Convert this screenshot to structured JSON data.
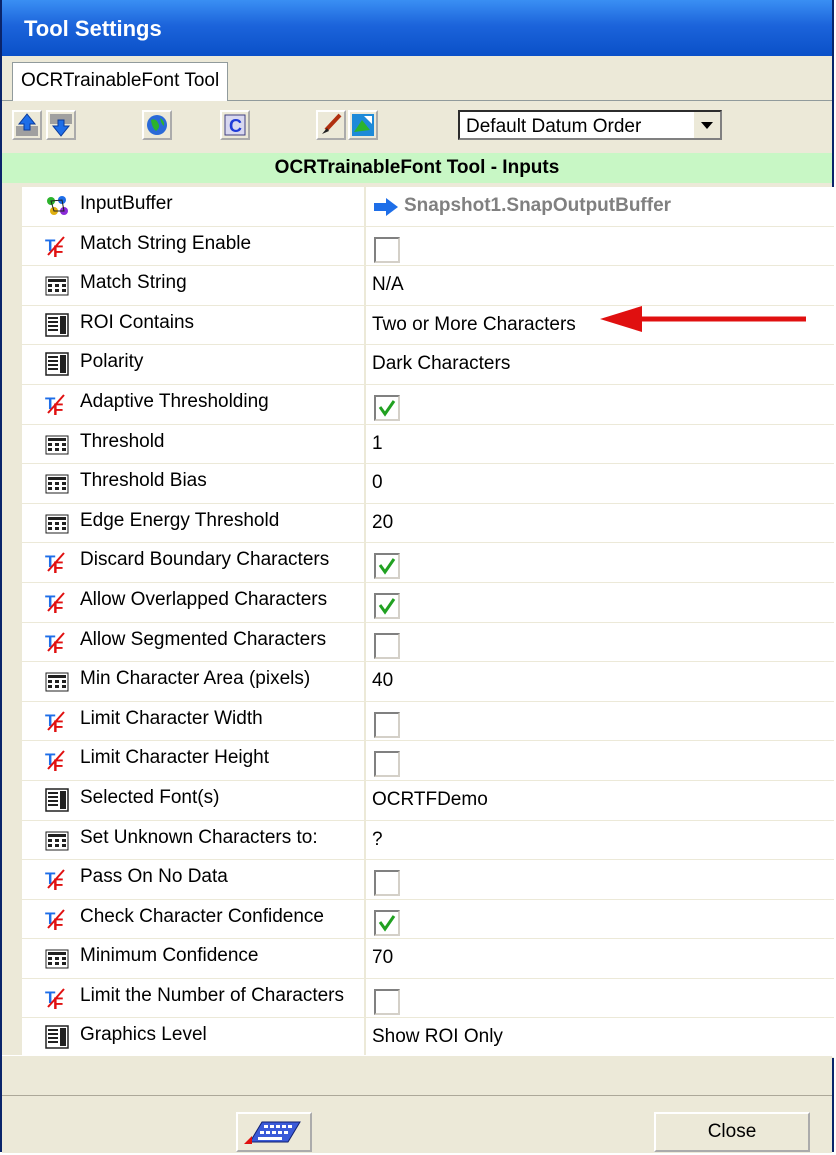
{
  "window": {
    "title": "Tool Settings"
  },
  "tabs": [
    {
      "label": "OCRTrainableFont Tool"
    }
  ],
  "toolbar": {
    "buttons": [
      {
        "icon": "arrow-up-icon"
      },
      {
        "icon": "arrow-down-icon"
      },
      {
        "icon": "globe-icon"
      },
      {
        "icon": "c-icon"
      },
      {
        "icon": "paint-brush-icon"
      },
      {
        "icon": "image-edit-icon"
      }
    ],
    "datum_order": {
      "selected": "Default Datum Order"
    }
  },
  "section": {
    "title": "OCRTrainableFont Tool - Inputs"
  },
  "rows": [
    {
      "label": "InputBuffer",
      "type": "link",
      "icon": "buffer-icon",
      "value": "Snapshot1.SnapOutputBuffer"
    },
    {
      "label": "Match String Enable",
      "type": "bool",
      "icon": "tf-icon",
      "checked": false
    },
    {
      "label": "Match String",
      "type": "text",
      "icon": "numeric-icon",
      "value": "N/A"
    },
    {
      "label": "ROI Contains",
      "type": "text",
      "icon": "list-icon",
      "value": "Two or More Characters"
    },
    {
      "label": "Polarity",
      "type": "text",
      "icon": "list-icon",
      "value": "Dark Characters"
    },
    {
      "label": "Adaptive Thresholding",
      "type": "bool",
      "icon": "tf-icon",
      "checked": true
    },
    {
      "label": "Threshold",
      "type": "text",
      "icon": "numeric-icon",
      "value": "1"
    },
    {
      "label": "Threshold Bias",
      "type": "text",
      "icon": "numeric-icon",
      "value": "0"
    },
    {
      "label": "Edge Energy Threshold",
      "type": "text",
      "icon": "numeric-icon",
      "value": "20"
    },
    {
      "label": "Discard Boundary Characters",
      "type": "bool",
      "icon": "tf-icon",
      "checked": true
    },
    {
      "label": "Allow Overlapped Characters",
      "type": "bool",
      "icon": "tf-icon",
      "checked": true
    },
    {
      "label": "Allow Segmented Characters",
      "type": "bool",
      "icon": "tf-icon",
      "checked": false
    },
    {
      "label": "Min Character Area (pixels)",
      "type": "text",
      "icon": "numeric-icon",
      "value": "40"
    },
    {
      "label": "Limit Character Width",
      "type": "bool",
      "icon": "tf-icon",
      "checked": false
    },
    {
      "label": "Limit Character Height",
      "type": "bool",
      "icon": "tf-icon",
      "checked": false
    },
    {
      "label": "Selected Font(s)",
      "type": "text",
      "icon": "list-icon",
      "value": "OCRTFDemo"
    },
    {
      "label": "Set Unknown Characters to:",
      "type": "text",
      "icon": "numeric-icon",
      "value": "?"
    },
    {
      "label": "Pass On No Data",
      "type": "bool",
      "icon": "tf-icon",
      "checked": false
    },
    {
      "label": "Check Character Confidence",
      "type": "bool",
      "icon": "tf-icon",
      "checked": true
    },
    {
      "label": "Minimum Confidence",
      "type": "text",
      "icon": "numeric-icon",
      "value": "70"
    },
    {
      "label": "Limit the Number of Characters",
      "type": "bool",
      "icon": "tf-icon",
      "checked": false
    },
    {
      "label": "Graphics Level",
      "type": "text",
      "icon": "list-icon",
      "value": "Show ROI Only"
    }
  ],
  "annotation": {
    "icon": "red-arrow-icon",
    "color": "#e01010"
  },
  "footer": {
    "keyboard_icon": "keyboard-icon",
    "close_label": "Close"
  },
  "colors": {
    "title_bar": "#0a50c8",
    "section_header": "#c8f7c5",
    "window_bg": "#ece9d8",
    "link_arrow": "#1e6ee8"
  }
}
